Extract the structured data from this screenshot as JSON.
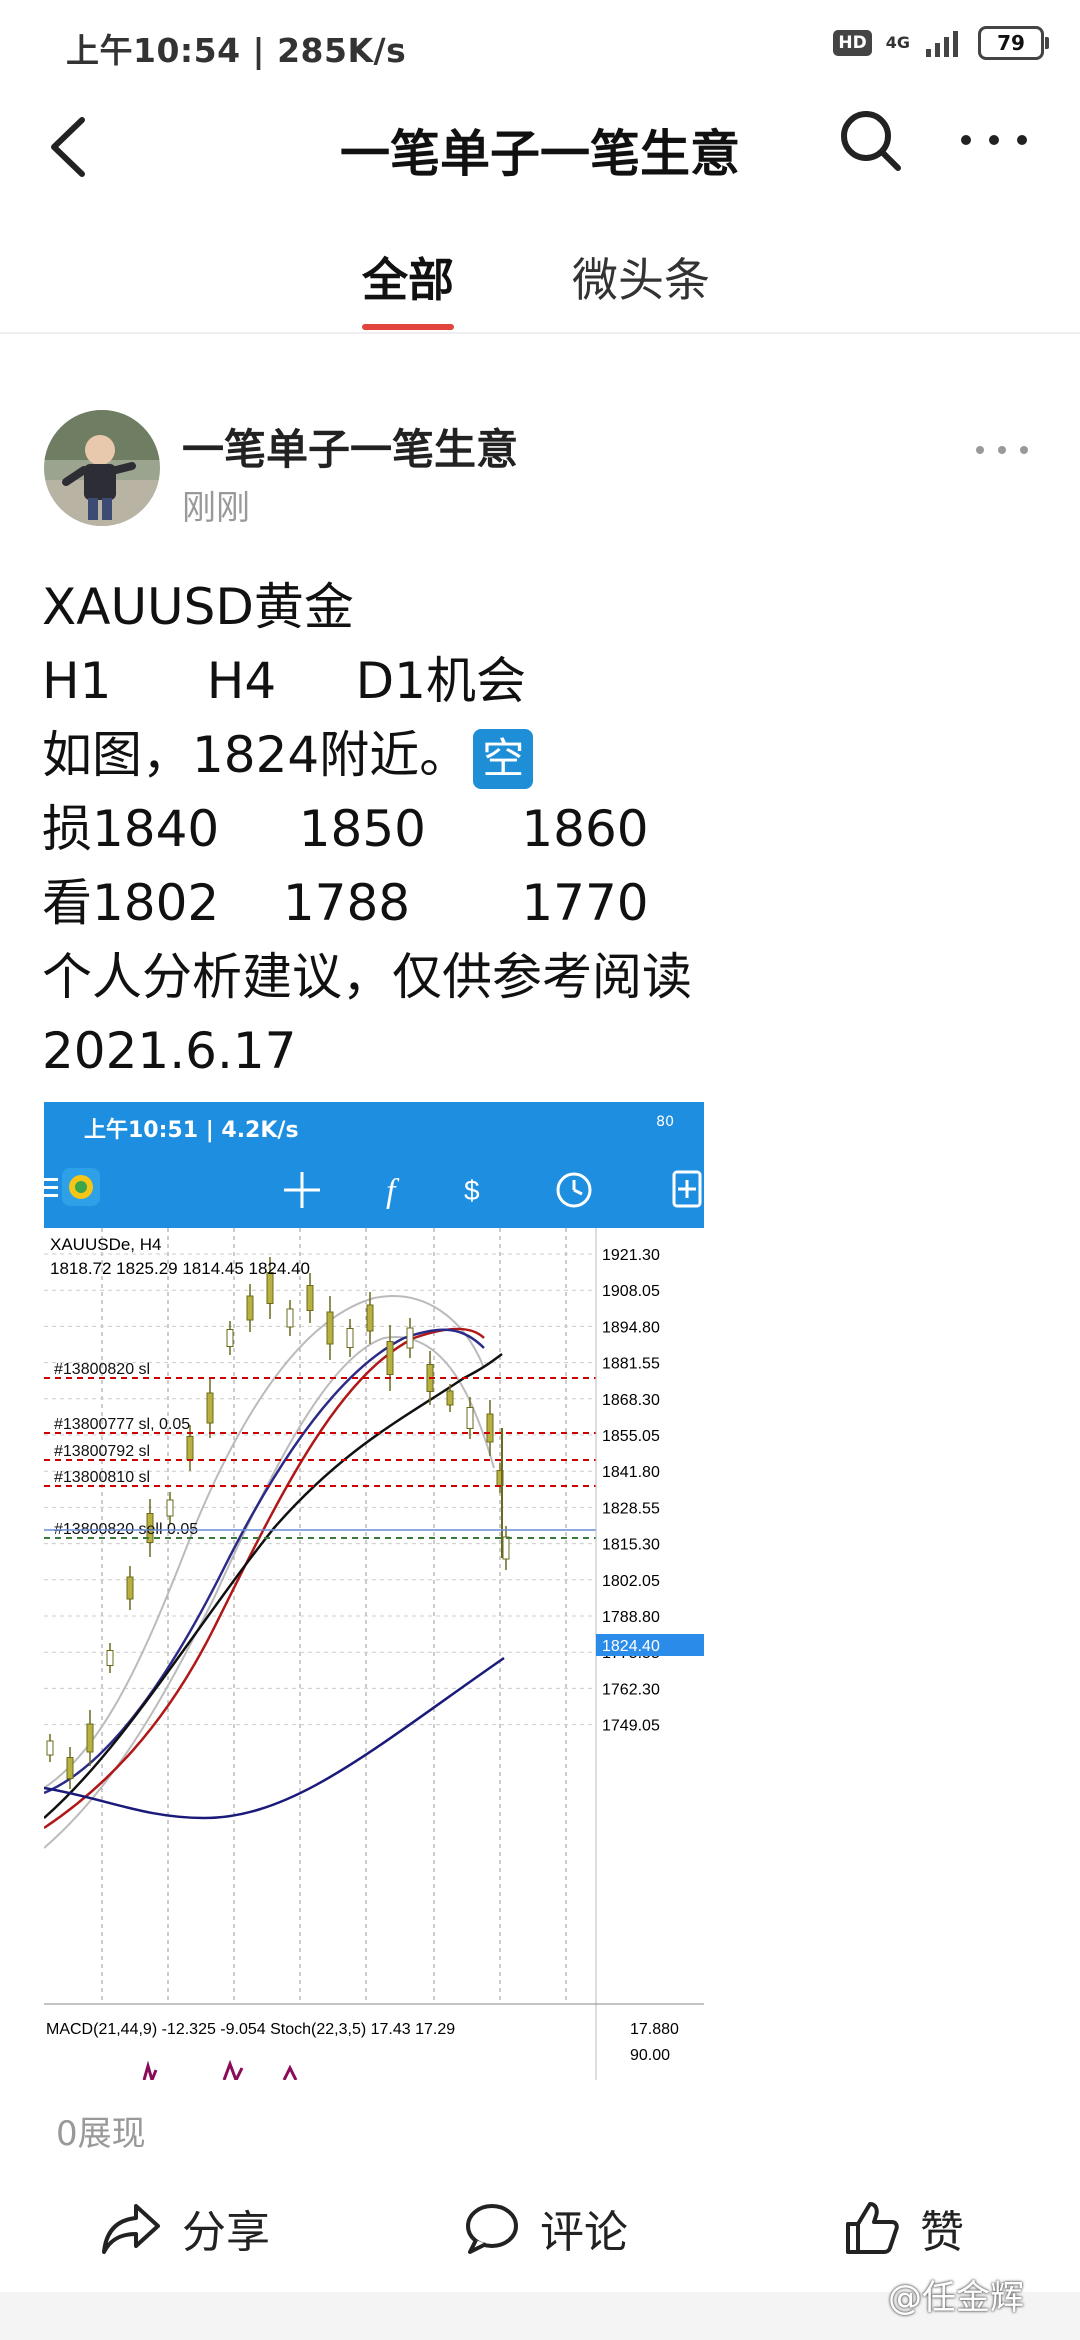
{
  "status_bar": {
    "time": "上午10:54 | 285K/s",
    "network": "4G",
    "battery": "79"
  },
  "nav": {
    "title": "一笔单子一笔生意"
  },
  "tabs": [
    {
      "label": "全部",
      "active": true
    },
    {
      "label": "微头条",
      "active": false
    }
  ],
  "post": {
    "author": "一笔单子一笔生意",
    "time": "刚刚",
    "lines": [
      "XAUUSD黄金",
      "H1      H4     D1机会",
      "如图，1824附近。",
      "损1840     1850      1860",
      "看1802    1788       1770",
      "个人分析建议，仅供参考阅读",
      "2021.6.17"
    ],
    "emoji_label": "空",
    "impressions": "0展现"
  },
  "screenshot": {
    "status_time": "上午10:51 | 4.2K/s",
    "status_battery": "80",
    "symbol": "XAUUSDe, H4",
    "ohlc": "1818.72 1825.29 1814.45 1824.40",
    "current_price": "1824.40",
    "price_axis": [
      "1921.30",
      "1908.05",
      "1894.80",
      "1881.55",
      "1868.30",
      "1855.05",
      "1841.80",
      "1828.55",
      "1815.30",
      "1802.05",
      "1788.80",
      "1775.55",
      "1762.30",
      "1749.05"
    ],
    "orders": [
      "#13800820 sl",
      "#13800777 sl, 0.05",
      "#13800792 sl",
      "#13800810 sl",
      "#13800820 sell 0.05"
    ],
    "indicator_line": "MACD(21,44,9) -12.325 -9.054 Stoch(22,3,5) 17.43 17.29",
    "indicator_value": "17.880",
    "indicator_max": "90.00"
  },
  "actions": {
    "share": "分享",
    "comment": "评论",
    "like": "赞"
  },
  "watermark": "@任金辉",
  "colors": {
    "accent": "#e1453b",
    "mt4_blue": "#1e8fe0"
  }
}
